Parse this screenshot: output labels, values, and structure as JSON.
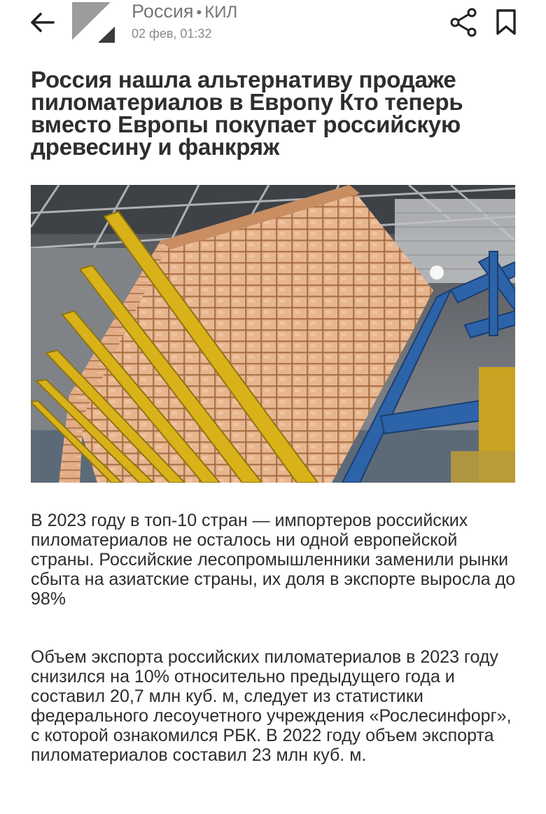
{
  "header": {
    "source_name": "Россия",
    "separator": "•",
    "source_tag": "КИЛ",
    "date": "02 фев, 01:32",
    "back_icon": "arrow-left-icon",
    "share_icon": "share-icon",
    "bookmark_icon": "bookmark-icon"
  },
  "article": {
    "title": "Россия нашла альтернативу продаже пиломатериалов в Европу Кто теперь вместо Европы покупает российскую древесину и фанкряж",
    "paragraphs": [
      "В 2023 году в топ-10 стран — импортеров российских пиломатериалов не осталось ни одной европейской страны. Российские лесопромышленники заменили рынки сбыта на азиатские страны, их доля в экспорте выросла до 98%",
      "Объем экспорта российских пиломатериалов в 2023 году снизился на 10% относительно предыдущего года и составил 20,7 млн куб. м, следует из статистики федерального лесоучетного учреждения «Рослесинфорг», с которой ознакомился РБК. В 2022 году объем экспорта пиломатериалов составил 23 млн куб. м."
    ]
  },
  "colors": {
    "text": "#2d2d2d",
    "muted": "#8a8a8a",
    "logo_gray": "#9a9a9a",
    "logo_dark": "#3a3a3a"
  }
}
